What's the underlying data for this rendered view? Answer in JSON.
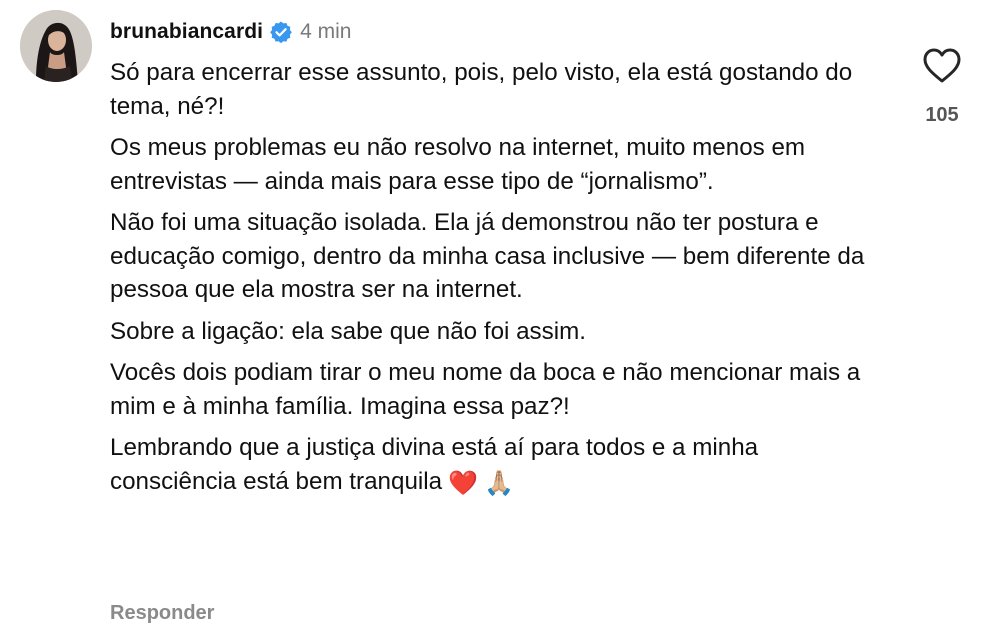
{
  "comment": {
    "username": "brunabiancardi",
    "timestamp": "4 min",
    "verified_icon": "verified-badge-icon",
    "verified_color": "#3897f0",
    "paragraphs": [
      "Só para encerrar esse assunto, pois, pelo visto, ela está gostando do tema, né?!",
      "Os meus problemas eu não resolvo na internet, muito menos em entrevistas — ainda mais para esse tipo de “jornalismo”.",
      "Não foi uma situação isolada. Ela já demonstrou não ter postura e educação comigo, dentro da minha casa inclusive — bem diferente da pessoa que ela mostra ser na internet.",
      "Sobre a ligação: ela sabe que não foi assim.",
      "Vocês dois podiam tirar o meu nome da boca e não mencionar mais a mim e à minha família. Imagina essa paz?!",
      "Lembrando que a justiça divina está aí para todos e a minha consciência está bem tranquila"
    ],
    "emojis": [
      "❤️",
      "🙏🏼"
    ],
    "reply_label": "Responder",
    "like_icon": "heart-outline-icon",
    "like_count": "105"
  }
}
